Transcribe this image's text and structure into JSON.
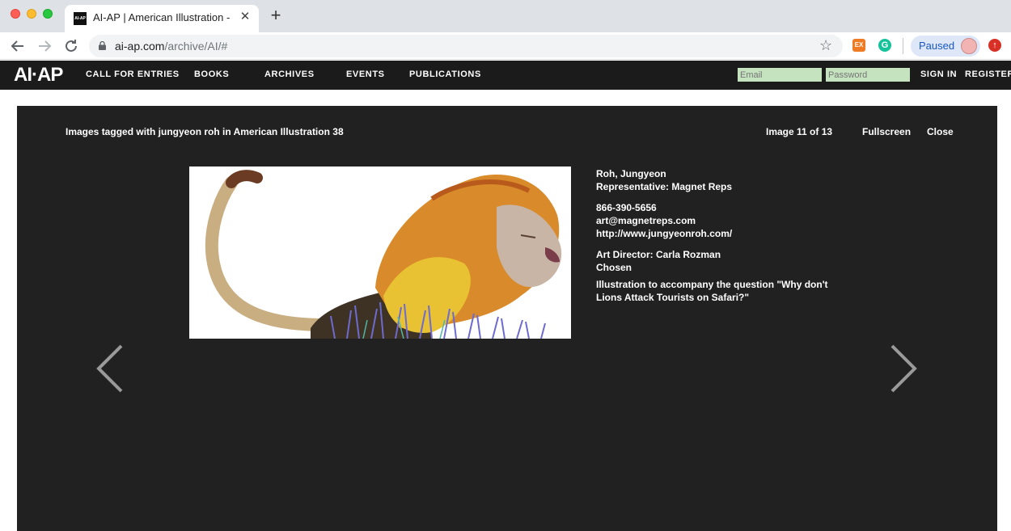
{
  "browser": {
    "tab_title": "AI-AP | American Illustration - ",
    "tab_favicon_text": "AI-AP",
    "url_host": "ai-ap.com",
    "url_path": "/archive/AI/#",
    "ext1_label": "EX",
    "ext2_label": "G",
    "profile_label": "Paused"
  },
  "site": {
    "logo": "AI·AP",
    "nav": [
      "CALL FOR ENTRIES",
      "BOOKS",
      "ARCHIVES",
      "EVENTS",
      "PUBLICATIONS"
    ],
    "email_placeholder": "Email",
    "password_placeholder": "Password",
    "sign_in": "SIGN IN",
    "register": "REGISTER"
  },
  "lightbox": {
    "heading": "Images tagged with jungyeon roh in American Illustration 38",
    "counter": "Image 11 of 13",
    "fullscreen": "Fullscreen",
    "close": "Close",
    "artist": "Roh, Jungyeon",
    "representative": "Representative: Magnet Reps",
    "phone": "866-390-5656",
    "email": "art@magnetreps.com",
    "website": "http://www.jungyeonroh.com/",
    "art_director": "Art Director: Carla Rozman",
    "status": "Chosen",
    "description": "Illustration to accompany the question \"Why don't Lions Attack Tourists on Safari?\""
  },
  "colors": {
    "site_bg": "#1b1b1b",
    "lightbox_bg": "#212121",
    "login_field": "#c5e3be"
  }
}
